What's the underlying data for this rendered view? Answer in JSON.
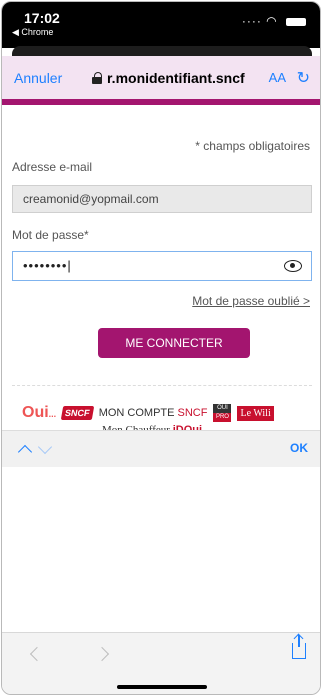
{
  "status": {
    "time": "17:02",
    "back_app": "◀ Chrome",
    "signal": "····"
  },
  "browser": {
    "cancel_label": "Annuler",
    "url": "r.monidentifiant.sncf",
    "text_size_label": "AA",
    "reload_symbol": "↻"
  },
  "form": {
    "required_note": "* champs obligatoires",
    "email_label": "Adresse e-mail",
    "email_value": "creamonid@yopmail.com",
    "password_label": "Mot de passe*",
    "password_value": "••••••••|",
    "forgot_link": "Mot de passe oublié >",
    "submit_label": "ME CONNECTER"
  },
  "logos": {
    "oui": "Oui",
    "oui_suffix": "...",
    "sncf": "SNCF",
    "mon_compte": "MON COMPTE",
    "mon_compte_sncf": "SNCF",
    "pro_top": "OUI",
    "pro_bottom": "PRO",
    "wili": "Le Wili",
    "chauffeur": "Mon Chauffeur",
    "chauffeur_brand": "iDOui"
  },
  "keyboard_bar": {
    "done_label": "OK"
  },
  "colors": {
    "brand": "#a3156f",
    "link": "#1e80ff",
    "nav_bg": "#f3e3f2"
  }
}
